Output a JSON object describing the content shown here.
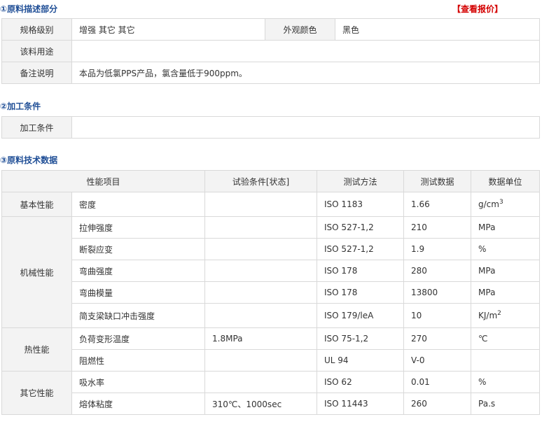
{
  "sections": {
    "desc_title": "①原料描述部分",
    "quote_link": "【查看报价】",
    "proc_title": "②加工条件",
    "tech_title": "③原料技术数据"
  },
  "desc": {
    "grade_label": "规格级别",
    "grade_value": "增强 其它 其它",
    "color_label": "外观颜色",
    "color_value": "黑色",
    "use_label": "该料用途",
    "use_value": "",
    "note_label": "备注说明",
    "note_value": "本品为低氯PPS产品，氯含量低于900ppm。"
  },
  "proc": {
    "label": "加工条件",
    "value": ""
  },
  "tech": {
    "headers": [
      "性能项目",
      "试验条件[状态]",
      "测试方法",
      "测试数据",
      "数据单位"
    ],
    "groups": [
      "基本性能",
      "机械性能",
      "热性能",
      "其它性能"
    ],
    "rows": [
      {
        "item": "密度",
        "cond": "",
        "method": "ISO 1183",
        "value": "1.66",
        "unit": "g/cm",
        "sup": "3"
      },
      {
        "item": "拉伸强度",
        "cond": "",
        "method": "ISO 527-1,2",
        "value": "210",
        "unit": "MPa",
        "sup": ""
      },
      {
        "item": "断裂应变",
        "cond": "",
        "method": "ISO 527-1,2",
        "value": "1.9",
        "unit": "%",
        "sup": ""
      },
      {
        "item": "弯曲强度",
        "cond": "",
        "method": "ISO 178",
        "value": "280",
        "unit": "MPa",
        "sup": ""
      },
      {
        "item": "弯曲模量",
        "cond": "",
        "method": "ISO 178",
        "value": "13800",
        "unit": "MPa",
        "sup": ""
      },
      {
        "item": "简支梁缺口冲击强度",
        "cond": "",
        "method": "ISO 179/leA",
        "value": "10",
        "unit": "KJ/m",
        "sup": "2"
      },
      {
        "item": "负荷变形温度",
        "cond": "1.8MPa",
        "method": "ISO 75-1,2",
        "value": "270",
        "unit": "℃",
        "sup": ""
      },
      {
        "item": "阻燃性",
        "cond": "",
        "method": "UL 94",
        "value": "V-0",
        "unit": "",
        "sup": ""
      },
      {
        "item": "吸水率",
        "cond": "",
        "method": "ISO 62",
        "value": "0.01",
        "unit": "%",
        "sup": ""
      },
      {
        "item": "熔体粘度",
        "cond": "310℃、1000sec",
        "method": "ISO 11443",
        "value": "260",
        "unit": "Pa.s",
        "sup": ""
      }
    ]
  }
}
